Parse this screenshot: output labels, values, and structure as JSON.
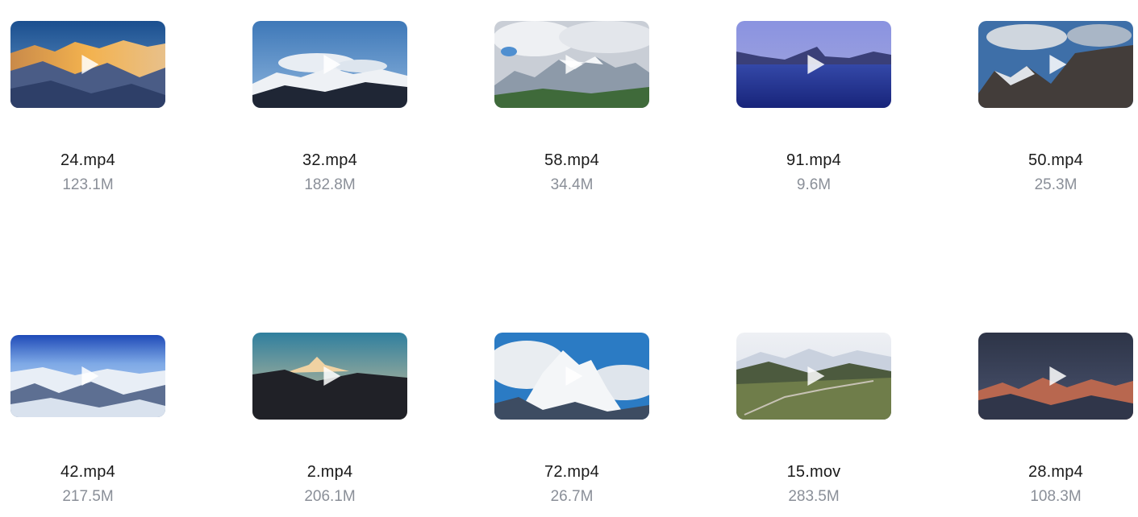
{
  "files": [
    {
      "name": "24.mp4",
      "size": "123.1M",
      "thumbnail": "alpine-sunset-thumbnail"
    },
    {
      "name": "32.mp4",
      "size": "182.8M",
      "thumbnail": "mountain-clouds-thumbnail"
    },
    {
      "name": "58.mp4",
      "size": "34.4M",
      "thumbnail": "cloudy-peaks-thumbnail"
    },
    {
      "name": "91.mp4",
      "size": "9.6M",
      "thumbnail": "twilight-lake-thumbnail"
    },
    {
      "name": "50.mp4",
      "size": "25.3M",
      "thumbnail": "dark-ridge-thumbnail"
    },
    {
      "name": "42.mp4",
      "size": "217.5M",
      "thumbnail": "aerial-snow-range-thumbnail"
    },
    {
      "name": "2.mp4",
      "size": "206.1M",
      "thumbnail": "distant-peak-thumbnail"
    },
    {
      "name": "72.mp4",
      "size": "26.7M",
      "thumbnail": "snowy-summit-thumbnail"
    },
    {
      "name": "15.mov",
      "size": "283.5M",
      "thumbnail": "valley-road-thumbnail"
    },
    {
      "name": "28.mp4",
      "size": "108.3M",
      "thumbnail": "alpenglow-dusk-thumbnail"
    }
  ],
  "play_icon": "play-icon"
}
